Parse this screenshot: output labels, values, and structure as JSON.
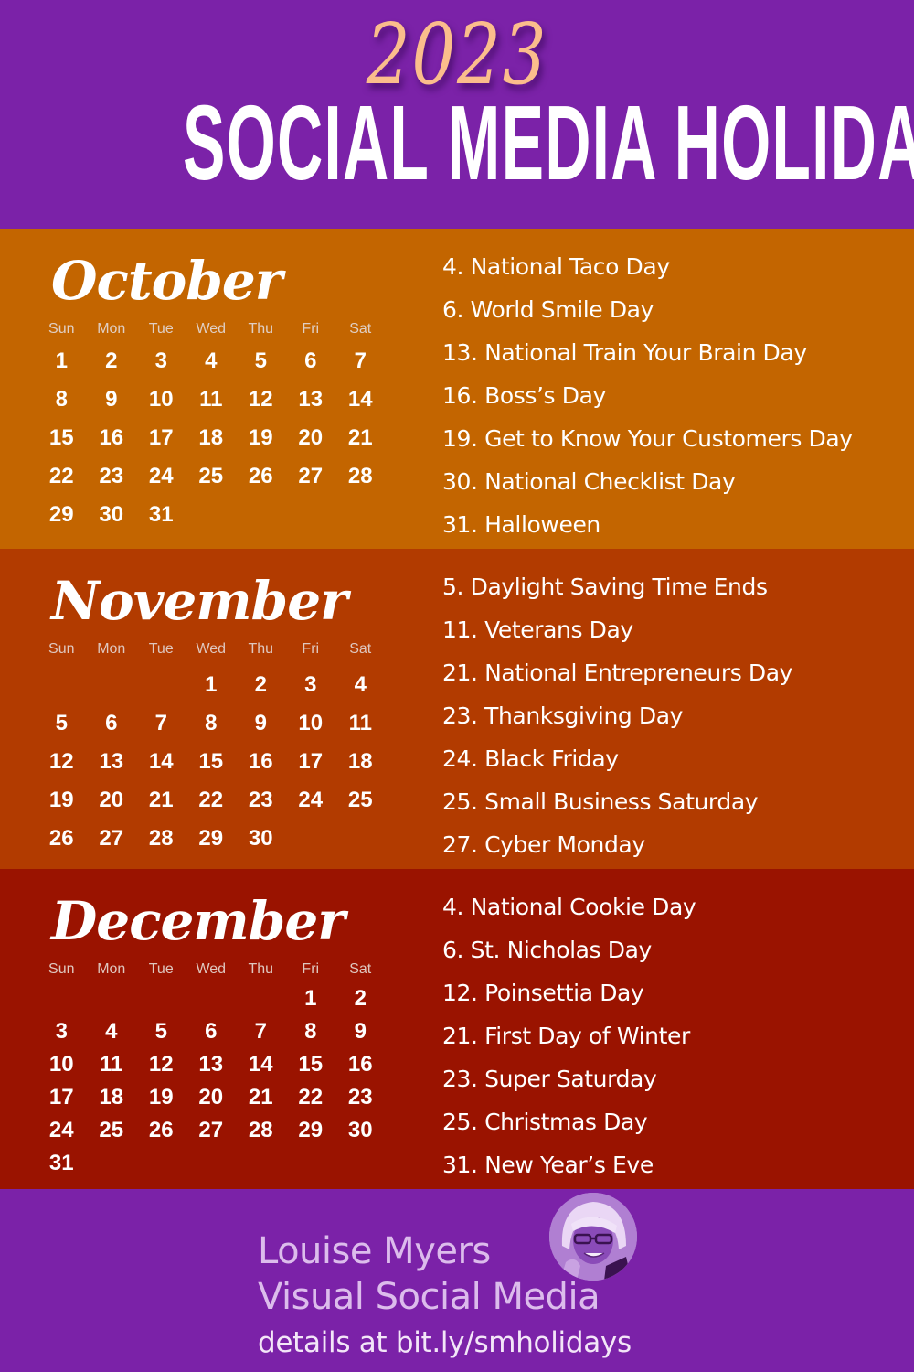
{
  "header": {
    "year": "2023",
    "title": "SOCIAL MEDIA HOLIDAYS"
  },
  "colors": {
    "background_purple": "#7b22a8",
    "year_peach": "#fbbd8c",
    "october": "#c36500",
    "november": "#b23b00",
    "december": "#9a1300"
  },
  "weekdays": [
    "Sun",
    "Mon",
    "Tue",
    "Wed",
    "Thu",
    "Fri",
    "Sat"
  ],
  "months": [
    {
      "name": "October",
      "weeks": [
        [
          "1",
          "2",
          "3",
          "4",
          "5",
          "6",
          "7"
        ],
        [
          "8",
          "9",
          "10",
          "11",
          "12",
          "13",
          "14"
        ],
        [
          "15",
          "16",
          "17",
          "18",
          "19",
          "20",
          "21"
        ],
        [
          "22",
          "23",
          "24",
          "25",
          "26",
          "27",
          "28"
        ],
        [
          "29",
          "30",
          "31",
          "",
          "",
          "",
          ""
        ]
      ],
      "holidays": [
        "4. National Taco Day",
        "6. World Smile Day",
        "13. National Train Your Brain Day",
        "16. Boss’s Day",
        "19. Get to Know Your Customers Day",
        "30. National Checklist Day",
        "31. Halloween"
      ]
    },
    {
      "name": "November",
      "weeks": [
        [
          "",
          "",
          "",
          "1",
          "2",
          "3",
          "4"
        ],
        [
          "5",
          "6",
          "7",
          "8",
          "9",
          "10",
          "11"
        ],
        [
          "12",
          "13",
          "14",
          "15",
          "16",
          "17",
          "18"
        ],
        [
          "19",
          "20",
          "21",
          "22",
          "23",
          "24",
          "25"
        ],
        [
          "26",
          "27",
          "28",
          "29",
          "30",
          "",
          ""
        ]
      ],
      "holidays": [
        "5. Daylight Saving Time Ends",
        "11. Veterans Day",
        "21. National Entrepreneurs Day",
        "23. Thanksgiving Day",
        "24. Black Friday",
        "25. Small Business Saturday",
        "27. Cyber Monday"
      ]
    },
    {
      "name": "December",
      "weeks": [
        [
          "",
          "",
          "",
          "",
          "",
          "1",
          "2"
        ],
        [
          "3",
          "4",
          "5",
          "6",
          "7",
          "8",
          "9"
        ],
        [
          "10",
          "11",
          "12",
          "13",
          "14",
          "15",
          "16"
        ],
        [
          "17",
          "18",
          "19",
          "20",
          "21",
          "22",
          "23"
        ],
        [
          "24",
          "25",
          "26",
          "27",
          "28",
          "29",
          "30"
        ],
        [
          "31",
          "",
          "",
          "",
          "",
          "",
          ""
        ]
      ],
      "holidays": [
        "4. National Cookie Day",
        "6. St. Nicholas Day",
        "12. Poinsettia Day",
        "21. First Day of Winter",
        "23. Super Saturday",
        "25. Christmas Day",
        "31. New Year’s Eve"
      ]
    }
  ],
  "footer": {
    "author": "Louise Myers",
    "brand": "Visual Social Media",
    "link_text": "details at bit.ly/smholidays",
    "avatar_icon": "author-photo"
  }
}
